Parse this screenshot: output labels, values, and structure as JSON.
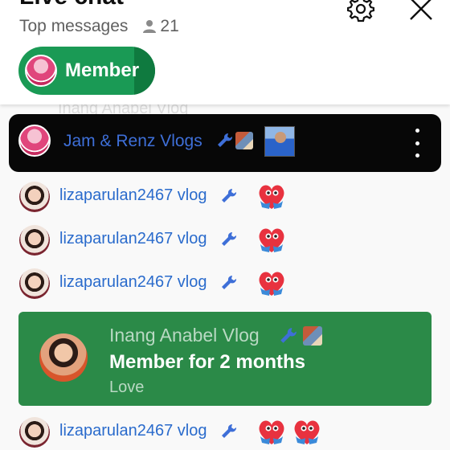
{
  "header": {
    "title": "Live chat",
    "mode_label": "Top messages",
    "viewer_count": "21",
    "settings_icon": "gear-icon",
    "close_icon": "close-icon"
  },
  "member_chip": {
    "label": "Member"
  },
  "ghost_text": "Inang Anabel Vlog",
  "pinned": {
    "author": "Jam & Renz Vlogs",
    "badge_icon": "wrench-icon",
    "menu_icon": "more-vert-icon"
  },
  "messages": [
    {
      "author": "lizaparulan2467 vlog",
      "emoji_count": 1
    },
    {
      "author": "lizaparulan2467 vlog",
      "emoji_count": 1
    },
    {
      "author": "lizaparulan2467 vlog",
      "emoji_count": 1
    },
    {
      "author": "lizaparulan2467 vlog",
      "emoji_count": 2
    }
  ],
  "membership": {
    "author": "Inang Anabel Vlog",
    "title": "Member for 2 months",
    "message": "Love"
  },
  "colors": {
    "accent_green": "#1a9a55",
    "membership_green": "#2b8a48",
    "name_blue": "#2a6bcc",
    "pinned_bg": "#070707"
  }
}
